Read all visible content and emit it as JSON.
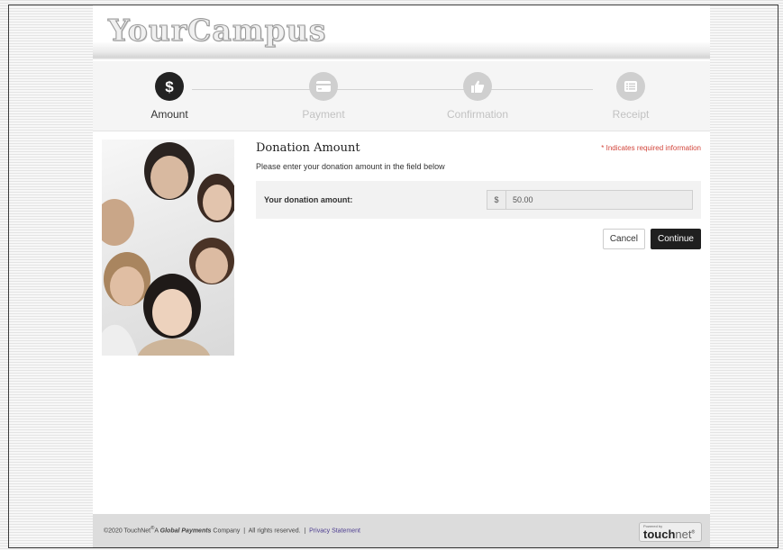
{
  "header": {
    "logo": "YourCampus"
  },
  "steps": [
    {
      "label": "Amount",
      "icon": "dollar-icon",
      "active": true
    },
    {
      "label": "Payment",
      "icon": "credit-card-icon",
      "active": false
    },
    {
      "label": "Confirmation",
      "icon": "thumbs-up-icon",
      "active": false
    },
    {
      "label": "Receipt",
      "icon": "list-icon",
      "active": false
    }
  ],
  "main": {
    "title": "Donation Amount",
    "required_note": "* Indicates required information",
    "subtitle": "Please enter your donation amount in the field below",
    "amount_label": "Your donation amount:",
    "currency_symbol": "$",
    "amount_value": "50.00",
    "cancel_label": "Cancel",
    "continue_label": "Continue"
  },
  "footer": {
    "copyright": "©2020 TouchNet",
    "registered": "®",
    "company_prefix": "A ",
    "company_brand": "Global Payments",
    "company_suffix": " Company",
    "separator": "|",
    "rights": "All rights reserved.",
    "privacy_link": "Privacy Statement",
    "powered_by": "Powered by",
    "touchnet_bold": "touch",
    "touchnet_light": "net",
    "touchnet_mark": "®"
  },
  "colors": {
    "accent_dark": "#222222",
    "inactive_step": "#cfcfcf",
    "required_red": "#d2463c",
    "link_purple": "#4b3b8f"
  }
}
